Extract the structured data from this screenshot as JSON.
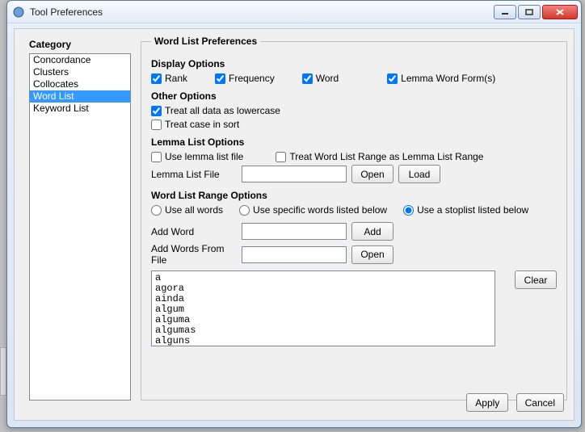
{
  "window": {
    "title": "Tool Preferences"
  },
  "category": {
    "label": "Category",
    "items": [
      "Concordance",
      "Clusters",
      "Collocates",
      "Word List",
      "Keyword List"
    ],
    "selected_index": 3
  },
  "panel": {
    "legend": "Word List Preferences",
    "display": {
      "heading": "Display Options",
      "rank": "Rank",
      "frequency": "Frequency",
      "word": "Word",
      "lemma_forms": "Lemma Word Form(s)",
      "rank_on": true,
      "frequency_on": true,
      "word_on": true,
      "lemma_forms_on": true
    },
    "other": {
      "heading": "Other Options",
      "lowercase": "Treat all data as lowercase",
      "lowercase_on": true,
      "case_sort": "Treat case in sort",
      "case_sort_on": false
    },
    "lemma": {
      "heading": "Lemma List Options",
      "use_file": "Use lemma list file",
      "use_file_on": false,
      "treat_range": "Treat Word List Range as Lemma List Range",
      "treat_range_on": false,
      "file_label": "Lemma List File",
      "file_value": "",
      "open": "Open",
      "load": "Load"
    },
    "range": {
      "heading": "Word List Range Options",
      "use_all": "Use all words",
      "use_specific": "Use specific words listed below",
      "use_stoplist": "Use a stoplist listed below",
      "selected": "stoplist",
      "add_word_label": "Add Word",
      "add_word_value": "",
      "add_btn": "Add",
      "add_file_label": "Add Words From File",
      "add_file_value": "",
      "open_btn": "Open",
      "stoplist_text": "a\nagora\nainda\nalgum\nalguma\nalgumas\nalguns",
      "clear_btn": "Clear"
    }
  },
  "buttons": {
    "apply": "Apply",
    "cancel": "Cancel"
  }
}
